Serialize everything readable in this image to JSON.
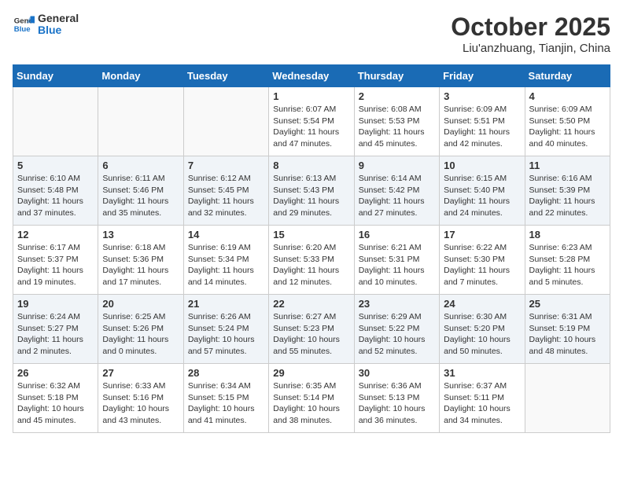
{
  "header": {
    "logo_line1": "General",
    "logo_line2": "Blue",
    "month": "October 2025",
    "location": "Liu'anzhuang, Tianjin, China"
  },
  "days_of_week": [
    "Sunday",
    "Monday",
    "Tuesday",
    "Wednesday",
    "Thursday",
    "Friday",
    "Saturday"
  ],
  "weeks": [
    [
      {
        "day": "",
        "info": ""
      },
      {
        "day": "",
        "info": ""
      },
      {
        "day": "",
        "info": ""
      },
      {
        "day": "1",
        "info": "Sunrise: 6:07 AM\nSunset: 5:54 PM\nDaylight: 11 hours\nand 47 minutes."
      },
      {
        "day": "2",
        "info": "Sunrise: 6:08 AM\nSunset: 5:53 PM\nDaylight: 11 hours\nand 45 minutes."
      },
      {
        "day": "3",
        "info": "Sunrise: 6:09 AM\nSunset: 5:51 PM\nDaylight: 11 hours\nand 42 minutes."
      },
      {
        "day": "4",
        "info": "Sunrise: 6:09 AM\nSunset: 5:50 PM\nDaylight: 11 hours\nand 40 minutes."
      }
    ],
    [
      {
        "day": "5",
        "info": "Sunrise: 6:10 AM\nSunset: 5:48 PM\nDaylight: 11 hours\nand 37 minutes."
      },
      {
        "day": "6",
        "info": "Sunrise: 6:11 AM\nSunset: 5:46 PM\nDaylight: 11 hours\nand 35 minutes."
      },
      {
        "day": "7",
        "info": "Sunrise: 6:12 AM\nSunset: 5:45 PM\nDaylight: 11 hours\nand 32 minutes."
      },
      {
        "day": "8",
        "info": "Sunrise: 6:13 AM\nSunset: 5:43 PM\nDaylight: 11 hours\nand 29 minutes."
      },
      {
        "day": "9",
        "info": "Sunrise: 6:14 AM\nSunset: 5:42 PM\nDaylight: 11 hours\nand 27 minutes."
      },
      {
        "day": "10",
        "info": "Sunrise: 6:15 AM\nSunset: 5:40 PM\nDaylight: 11 hours\nand 24 minutes."
      },
      {
        "day": "11",
        "info": "Sunrise: 6:16 AM\nSunset: 5:39 PM\nDaylight: 11 hours\nand 22 minutes."
      }
    ],
    [
      {
        "day": "12",
        "info": "Sunrise: 6:17 AM\nSunset: 5:37 PM\nDaylight: 11 hours\nand 19 minutes."
      },
      {
        "day": "13",
        "info": "Sunrise: 6:18 AM\nSunset: 5:36 PM\nDaylight: 11 hours\nand 17 minutes."
      },
      {
        "day": "14",
        "info": "Sunrise: 6:19 AM\nSunset: 5:34 PM\nDaylight: 11 hours\nand 14 minutes."
      },
      {
        "day": "15",
        "info": "Sunrise: 6:20 AM\nSunset: 5:33 PM\nDaylight: 11 hours\nand 12 minutes."
      },
      {
        "day": "16",
        "info": "Sunrise: 6:21 AM\nSunset: 5:31 PM\nDaylight: 11 hours\nand 10 minutes."
      },
      {
        "day": "17",
        "info": "Sunrise: 6:22 AM\nSunset: 5:30 PM\nDaylight: 11 hours\nand 7 minutes."
      },
      {
        "day": "18",
        "info": "Sunrise: 6:23 AM\nSunset: 5:28 PM\nDaylight: 11 hours\nand 5 minutes."
      }
    ],
    [
      {
        "day": "19",
        "info": "Sunrise: 6:24 AM\nSunset: 5:27 PM\nDaylight: 11 hours\nand 2 minutes."
      },
      {
        "day": "20",
        "info": "Sunrise: 6:25 AM\nSunset: 5:26 PM\nDaylight: 11 hours\nand 0 minutes."
      },
      {
        "day": "21",
        "info": "Sunrise: 6:26 AM\nSunset: 5:24 PM\nDaylight: 10 hours\nand 57 minutes."
      },
      {
        "day": "22",
        "info": "Sunrise: 6:27 AM\nSunset: 5:23 PM\nDaylight: 10 hours\nand 55 minutes."
      },
      {
        "day": "23",
        "info": "Sunrise: 6:29 AM\nSunset: 5:22 PM\nDaylight: 10 hours\nand 52 minutes."
      },
      {
        "day": "24",
        "info": "Sunrise: 6:30 AM\nSunset: 5:20 PM\nDaylight: 10 hours\nand 50 minutes."
      },
      {
        "day": "25",
        "info": "Sunrise: 6:31 AM\nSunset: 5:19 PM\nDaylight: 10 hours\nand 48 minutes."
      }
    ],
    [
      {
        "day": "26",
        "info": "Sunrise: 6:32 AM\nSunset: 5:18 PM\nDaylight: 10 hours\nand 45 minutes."
      },
      {
        "day": "27",
        "info": "Sunrise: 6:33 AM\nSunset: 5:16 PM\nDaylight: 10 hours\nand 43 minutes."
      },
      {
        "day": "28",
        "info": "Sunrise: 6:34 AM\nSunset: 5:15 PM\nDaylight: 10 hours\nand 41 minutes."
      },
      {
        "day": "29",
        "info": "Sunrise: 6:35 AM\nSunset: 5:14 PM\nDaylight: 10 hours\nand 38 minutes."
      },
      {
        "day": "30",
        "info": "Sunrise: 6:36 AM\nSunset: 5:13 PM\nDaylight: 10 hours\nand 36 minutes."
      },
      {
        "day": "31",
        "info": "Sunrise: 6:37 AM\nSunset: 5:11 PM\nDaylight: 10 hours\nand 34 minutes."
      },
      {
        "day": "",
        "info": ""
      }
    ]
  ]
}
